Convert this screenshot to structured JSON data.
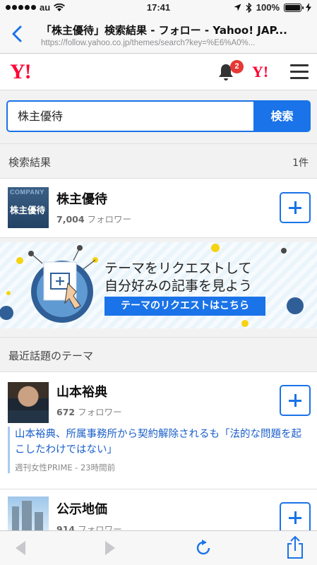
{
  "status_bar": {
    "carrier": "au",
    "time": "17:41",
    "battery": "100%"
  },
  "browser": {
    "title": "「株主優待」検索結果 - フォロー - Yahoo! JAP...",
    "url": "https://follow.yahoo.co.jp/themes/search?key=%E6%A0%..."
  },
  "header": {
    "logo": "Y!",
    "logo_small": "Y!",
    "notification_count": "2"
  },
  "search": {
    "value": "株主優待",
    "button": "検索"
  },
  "results": {
    "label": "検索結果",
    "count": "1件",
    "items": [
      {
        "thumb_small": "COMPANY",
        "thumb_big": "株主優待",
        "title": "株主優待",
        "followers": "7,004",
        "followers_suffix": "フォロワー"
      }
    ]
  },
  "banner": {
    "line1": "テーマをリクエストして",
    "line2": "自分好みの記事を見よう",
    "button": "テーマのリクエストはこちら"
  },
  "trending": {
    "label": "最近話題のテーマ",
    "items": [
      {
        "title": "山本裕典",
        "followers": "672",
        "followers_suffix": "フォロワー",
        "news": "山本裕典、所属事務所から契約解除されるも「法的な問題を起こしたわけではない」",
        "source": "週刊女性PRIME - 23時間前"
      },
      {
        "title": "公示地価",
        "followers": "914",
        "followers_suffix": "フォロワー"
      }
    ]
  }
}
